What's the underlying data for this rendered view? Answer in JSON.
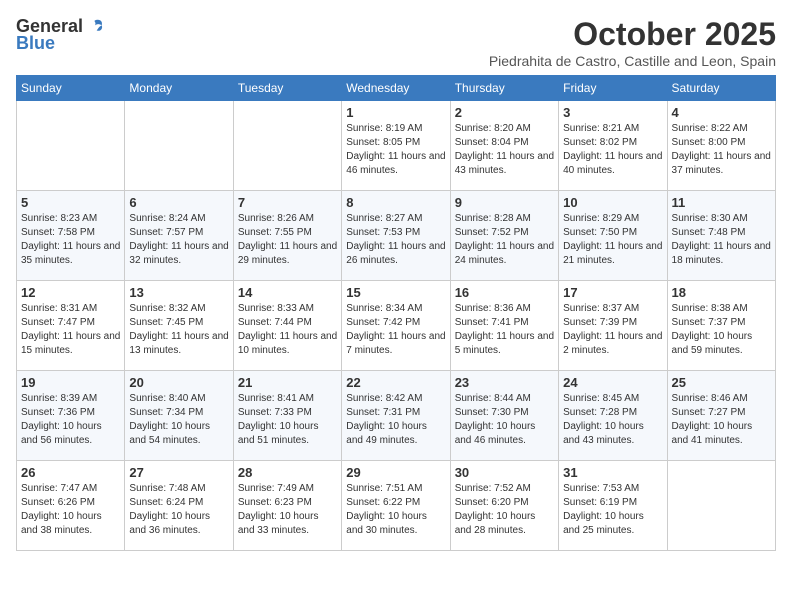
{
  "header": {
    "logo_general": "General",
    "logo_blue": "Blue",
    "month": "October 2025",
    "location": "Piedrahita de Castro, Castille and Leon, Spain"
  },
  "days_of_week": [
    "Sunday",
    "Monday",
    "Tuesday",
    "Wednesday",
    "Thursday",
    "Friday",
    "Saturday"
  ],
  "weeks": [
    [
      {
        "day": "",
        "info": ""
      },
      {
        "day": "",
        "info": ""
      },
      {
        "day": "",
        "info": ""
      },
      {
        "day": "1",
        "info": "Sunrise: 8:19 AM\nSunset: 8:05 PM\nDaylight: 11 hours and 46 minutes."
      },
      {
        "day": "2",
        "info": "Sunrise: 8:20 AM\nSunset: 8:04 PM\nDaylight: 11 hours and 43 minutes."
      },
      {
        "day": "3",
        "info": "Sunrise: 8:21 AM\nSunset: 8:02 PM\nDaylight: 11 hours and 40 minutes."
      },
      {
        "day": "4",
        "info": "Sunrise: 8:22 AM\nSunset: 8:00 PM\nDaylight: 11 hours and 37 minutes."
      }
    ],
    [
      {
        "day": "5",
        "info": "Sunrise: 8:23 AM\nSunset: 7:58 PM\nDaylight: 11 hours and 35 minutes."
      },
      {
        "day": "6",
        "info": "Sunrise: 8:24 AM\nSunset: 7:57 PM\nDaylight: 11 hours and 32 minutes."
      },
      {
        "day": "7",
        "info": "Sunrise: 8:26 AM\nSunset: 7:55 PM\nDaylight: 11 hours and 29 minutes."
      },
      {
        "day": "8",
        "info": "Sunrise: 8:27 AM\nSunset: 7:53 PM\nDaylight: 11 hours and 26 minutes."
      },
      {
        "day": "9",
        "info": "Sunrise: 8:28 AM\nSunset: 7:52 PM\nDaylight: 11 hours and 24 minutes."
      },
      {
        "day": "10",
        "info": "Sunrise: 8:29 AM\nSunset: 7:50 PM\nDaylight: 11 hours and 21 minutes."
      },
      {
        "day": "11",
        "info": "Sunrise: 8:30 AM\nSunset: 7:48 PM\nDaylight: 11 hours and 18 minutes."
      }
    ],
    [
      {
        "day": "12",
        "info": "Sunrise: 8:31 AM\nSunset: 7:47 PM\nDaylight: 11 hours and 15 minutes."
      },
      {
        "day": "13",
        "info": "Sunrise: 8:32 AM\nSunset: 7:45 PM\nDaylight: 11 hours and 13 minutes."
      },
      {
        "day": "14",
        "info": "Sunrise: 8:33 AM\nSunset: 7:44 PM\nDaylight: 11 hours and 10 minutes."
      },
      {
        "day": "15",
        "info": "Sunrise: 8:34 AM\nSunset: 7:42 PM\nDaylight: 11 hours and 7 minutes."
      },
      {
        "day": "16",
        "info": "Sunrise: 8:36 AM\nSunset: 7:41 PM\nDaylight: 11 hours and 5 minutes."
      },
      {
        "day": "17",
        "info": "Sunrise: 8:37 AM\nSunset: 7:39 PM\nDaylight: 11 hours and 2 minutes."
      },
      {
        "day": "18",
        "info": "Sunrise: 8:38 AM\nSunset: 7:37 PM\nDaylight: 10 hours and 59 minutes."
      }
    ],
    [
      {
        "day": "19",
        "info": "Sunrise: 8:39 AM\nSunset: 7:36 PM\nDaylight: 10 hours and 56 minutes."
      },
      {
        "day": "20",
        "info": "Sunrise: 8:40 AM\nSunset: 7:34 PM\nDaylight: 10 hours and 54 minutes."
      },
      {
        "day": "21",
        "info": "Sunrise: 8:41 AM\nSunset: 7:33 PM\nDaylight: 10 hours and 51 minutes."
      },
      {
        "day": "22",
        "info": "Sunrise: 8:42 AM\nSunset: 7:31 PM\nDaylight: 10 hours and 49 minutes."
      },
      {
        "day": "23",
        "info": "Sunrise: 8:44 AM\nSunset: 7:30 PM\nDaylight: 10 hours and 46 minutes."
      },
      {
        "day": "24",
        "info": "Sunrise: 8:45 AM\nSunset: 7:28 PM\nDaylight: 10 hours and 43 minutes."
      },
      {
        "day": "25",
        "info": "Sunrise: 8:46 AM\nSunset: 7:27 PM\nDaylight: 10 hours and 41 minutes."
      }
    ],
    [
      {
        "day": "26",
        "info": "Sunrise: 7:47 AM\nSunset: 6:26 PM\nDaylight: 10 hours and 38 minutes."
      },
      {
        "day": "27",
        "info": "Sunrise: 7:48 AM\nSunset: 6:24 PM\nDaylight: 10 hours and 36 minutes."
      },
      {
        "day": "28",
        "info": "Sunrise: 7:49 AM\nSunset: 6:23 PM\nDaylight: 10 hours and 33 minutes."
      },
      {
        "day": "29",
        "info": "Sunrise: 7:51 AM\nSunset: 6:22 PM\nDaylight: 10 hours and 30 minutes."
      },
      {
        "day": "30",
        "info": "Sunrise: 7:52 AM\nSunset: 6:20 PM\nDaylight: 10 hours and 28 minutes."
      },
      {
        "day": "31",
        "info": "Sunrise: 7:53 AM\nSunset: 6:19 PM\nDaylight: 10 hours and 25 minutes."
      },
      {
        "day": "",
        "info": ""
      }
    ]
  ]
}
